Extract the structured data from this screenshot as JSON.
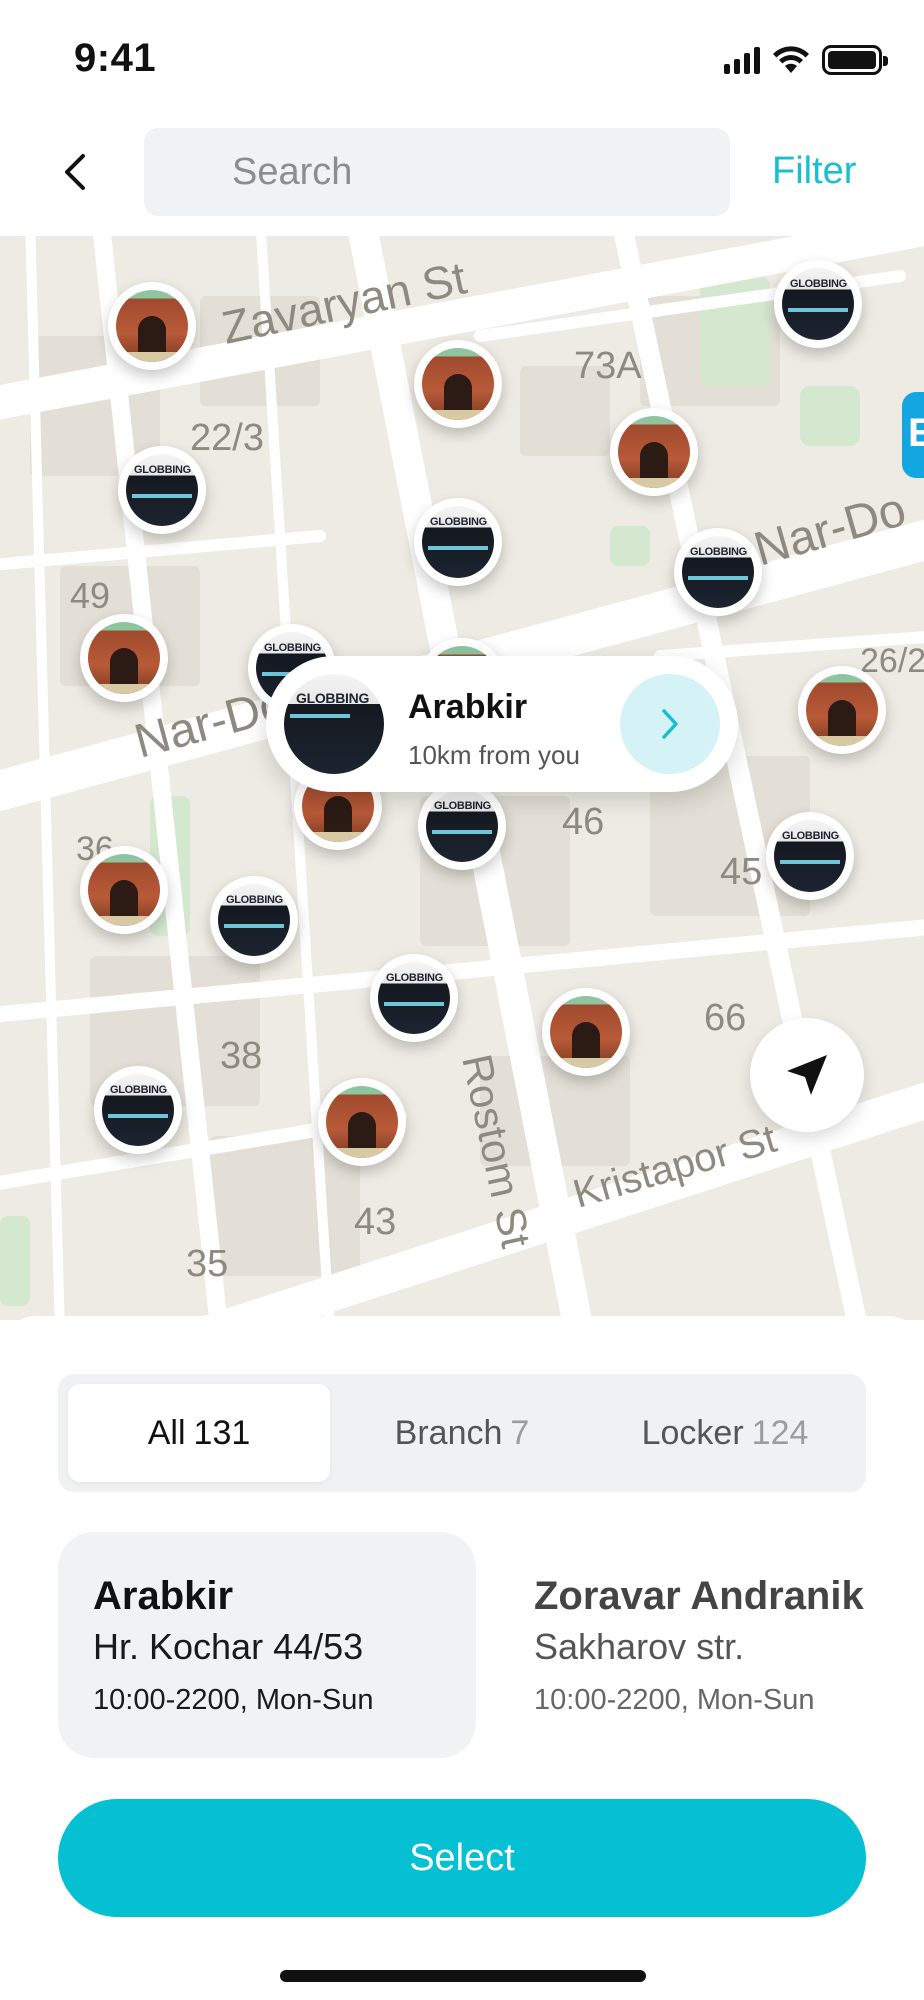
{
  "status_bar": {
    "time": "9:41"
  },
  "header": {
    "search_placeholder": "Search",
    "filter_label": "Filter"
  },
  "map": {
    "street_labels": [
      "Zavaryan St",
      "Nar-Dos St",
      "Rostom St",
      "Kristapor St",
      "Nar-Do",
      "22/3",
      "73A",
      "49",
      "46",
      "45",
      "66",
      "38",
      "43",
      "35",
      "26/2",
      "36"
    ],
    "pin_image_text": "GLOBBING",
    "popup": {
      "title": "Arabkir",
      "distance": "10km from you"
    }
  },
  "tabs": [
    {
      "label": "All",
      "count": "131",
      "active": true
    },
    {
      "label": "Branch",
      "count": "7",
      "active": false
    },
    {
      "label": "Locker",
      "count": "124",
      "active": false
    }
  ],
  "cards": [
    {
      "name": "Arabkir",
      "address": "Hr. Kochar 44/53",
      "hours": "10:00-2200, Mon-Sun",
      "selected": true
    },
    {
      "name": "Zoravar Andranik",
      "address": "Sakharov str.",
      "hours": "10:00-2200, Mon-Sun",
      "selected": false
    }
  ],
  "select_button_label": "Select",
  "colors": {
    "accent": "#05c0d3",
    "filter": "#19bfd0",
    "popup_go_bg": "#d5f3f7"
  }
}
